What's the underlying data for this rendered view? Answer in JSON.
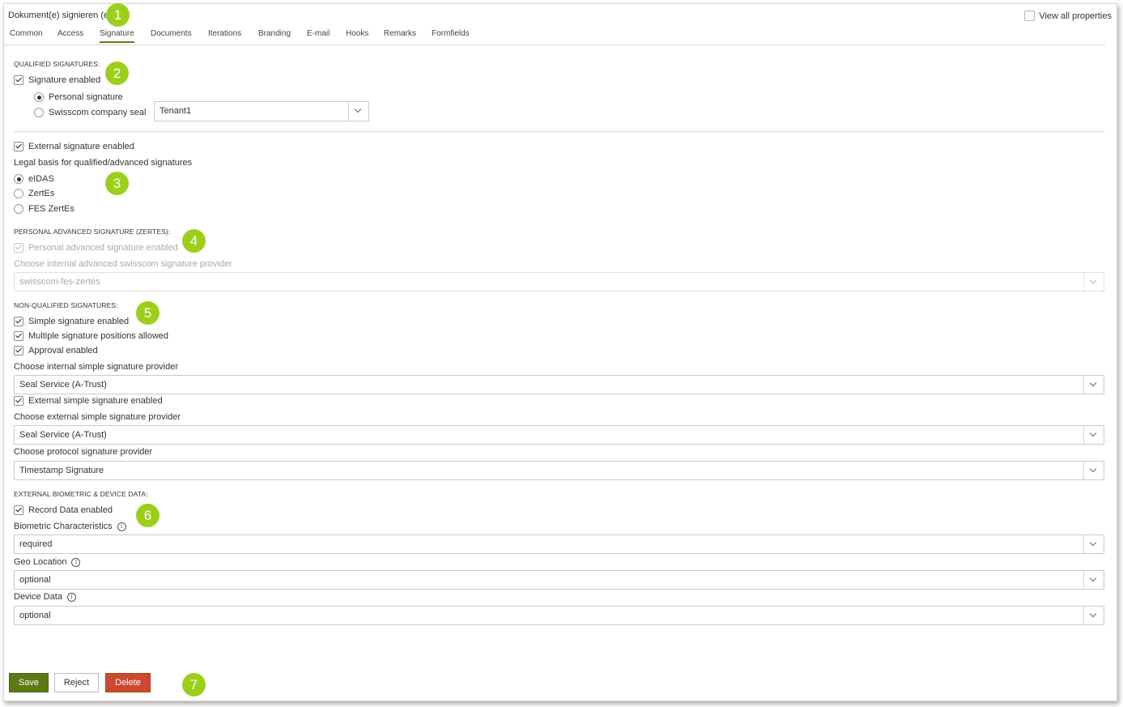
{
  "header": {
    "title": "Dokument(e) signieren (e",
    "view_all_label": "View all properties"
  },
  "tabs": [
    "Common",
    "Access",
    "Signature",
    "Documents",
    "Iterations",
    "Branding",
    "E-mail",
    "Hooks",
    "Remarks",
    "Formfields"
  ],
  "active_tab": "Signature",
  "qualified": {
    "title": "QUALIFIED SIGNATURES:",
    "signature_enabled": "Signature enabled",
    "personal_signature": "Personal signature",
    "company_seal": "Swisscom company seal",
    "tenant_value": "Tenant1"
  },
  "external": {
    "external_enabled": "External signature enabled",
    "legal_basis_label": "Legal basis for qualified/advanced signatures",
    "options": [
      "eIDAS",
      "ZertEs",
      "FES ZertEs"
    ]
  },
  "advanced": {
    "title": "PERSONAL ADVANCED SIGNATURE (ZERTES):",
    "enabled_label": "Personal advanced signature enabled",
    "provider_label": "Choose internal advanced swisscom signature provider",
    "provider_value": "swisscom-fes-zertes"
  },
  "non_qualified": {
    "title": "NON-QUALIFIED SIGNATURES:",
    "simple_enabled": "Simple signature enabled",
    "multiple_positions": "Multiple signature positions allowed",
    "approval_enabled": "Approval enabled",
    "internal_provider_label": "Choose internal simple signature provider",
    "internal_provider_value": "Seal Service (A-Trust)",
    "external_simple_enabled": "External simple signature enabled",
    "external_provider_label": "Choose external simple signature provider",
    "external_provider_value": "Seal Service (A-Trust)",
    "protocol_label": "Choose protocol signature provider",
    "protocol_value": "Timestamp Signature"
  },
  "biometric": {
    "title": "EXTERNAL BIOMETRIC & DEVICE DATA:",
    "record_enabled": "Record Data enabled",
    "biometric_label": "Biometric Characteristics",
    "biometric_value": "required",
    "geo_label": "Geo Location",
    "geo_value": "optional",
    "device_label": "Device Data",
    "device_value": "optional"
  },
  "buttons": {
    "save": "Save",
    "reject": "Reject",
    "delete": "Delete"
  },
  "badges": [
    "1",
    "2",
    "3",
    "4",
    "5",
    "6",
    "7"
  ],
  "colors": {
    "badge": "#9ccf1a",
    "save": "#5b7a13",
    "delete": "#c94a2c",
    "tab_underline": "#5b7f19"
  }
}
